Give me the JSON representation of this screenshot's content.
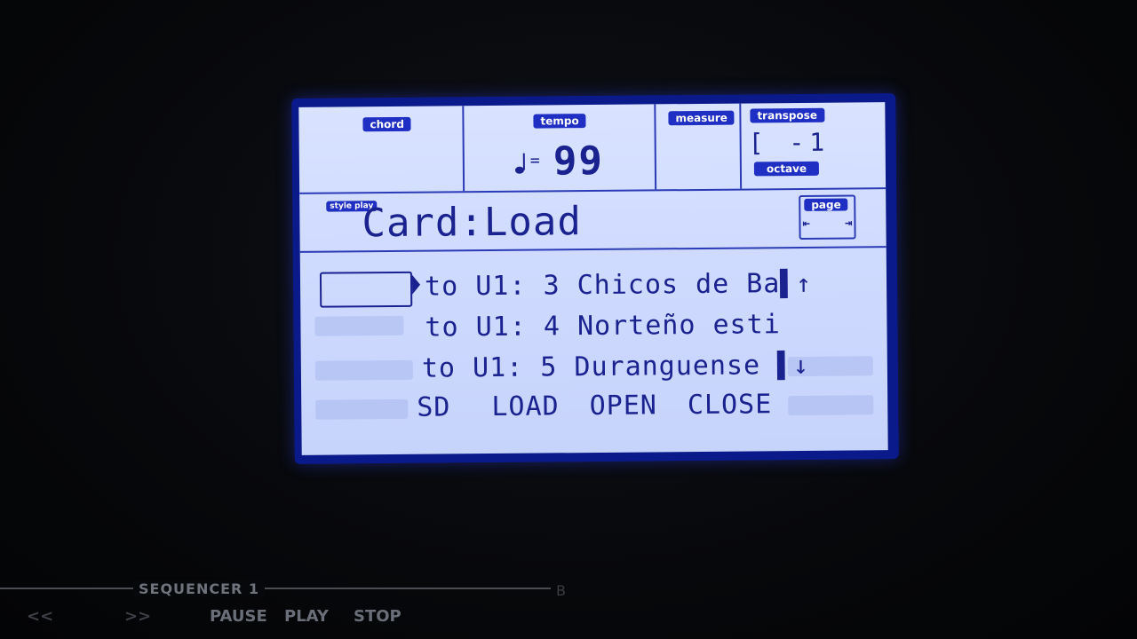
{
  "status": {
    "chord_label": "chord",
    "tempo_label": "tempo",
    "tempo_equals": "=",
    "tempo_value": "99",
    "measure_label": "measure",
    "transpose_label": "transpose",
    "transpose_value": "[ -1",
    "octave_label": "octave"
  },
  "header": {
    "mode_tag": "style play",
    "title": "Card:Load",
    "page_label": "page",
    "page_prev": "⇤",
    "page_next": "⇥"
  },
  "list": {
    "items": [
      {
        "text": "to U1: 3 Chicos de Ba",
        "scroll": "▌↑"
      },
      {
        "text": "to U1: 4 Norteño esti",
        "scroll": ""
      },
      {
        "text": "to U1: 5 Duranguense ",
        "scroll": "▌↓"
      }
    ]
  },
  "softkeys": [
    "SD",
    "LOAD",
    "OPEN",
    "CLOSE"
  ],
  "sequencer": {
    "label": "SEQUENCER 1",
    "rewind": "<<",
    "forward": ">>",
    "pause": "PAUSE",
    "play": "PLAY",
    "stop": "STOP",
    "b_label": "B"
  },
  "colors": {
    "lcd_bg": "#d3ddff",
    "lcd_ink": "#1a2290",
    "bezel": "#0b1a8a"
  }
}
